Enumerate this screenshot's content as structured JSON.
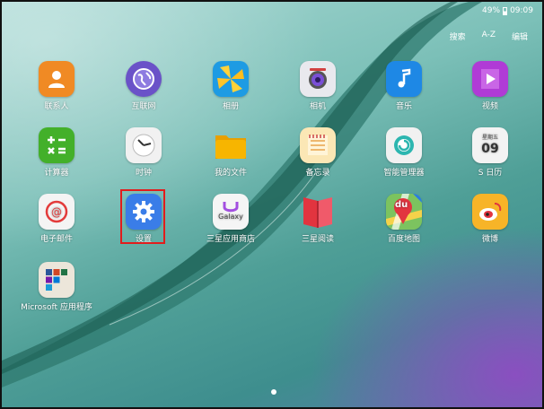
{
  "status": {
    "battery": "49%",
    "time": "09:09"
  },
  "topmenu": {
    "search": "搜索",
    "sort": "A-Z",
    "edit": "编辑"
  },
  "apps": [
    {
      "label": "联系人",
      "icon": "contacts-icon",
      "color": "#f08a24"
    },
    {
      "label": "互联网",
      "icon": "internet-icon",
      "color": "#6a52c8"
    },
    {
      "label": "相册",
      "icon": "gallery-icon",
      "color": "#f5c322"
    },
    {
      "label": "相机",
      "icon": "camera-icon",
      "color": "#e9e9ee"
    },
    {
      "label": "音乐",
      "icon": "music-icon",
      "color": "#1e88e5"
    },
    {
      "label": "视频",
      "icon": "video-icon",
      "color": "#b03bd6"
    },
    {
      "label": "计算器",
      "icon": "calculator-icon",
      "color": "#43b02a"
    },
    {
      "label": "时钟",
      "icon": "clock-icon",
      "color": "#f1f1f1"
    },
    {
      "label": "我的文件",
      "icon": "folder-icon",
      "color": "#f7b500"
    },
    {
      "label": "备忘录",
      "icon": "memo-icon",
      "color": "#fbe7b5"
    },
    {
      "label": "智能管理器",
      "icon": "smart-manager-icon",
      "color": "#f1f1f1"
    },
    {
      "label": "S 日历",
      "icon": "calendar-icon",
      "color": "#f3f3f3",
      "calendar_text": "星期五",
      "calendar_day": "09"
    },
    {
      "label": "电子邮件",
      "icon": "email-icon",
      "color": "#f4f4f4"
    },
    {
      "label": "设置",
      "icon": "settings-icon",
      "color": "#3a7de8"
    },
    {
      "label": "三星应用商店",
      "icon": "galaxy-apps-icon",
      "color": "#f5f5f5",
      "icon_text": "Galaxy"
    },
    {
      "label": "三星阅读",
      "icon": "reader-icon",
      "color": "#e2343f"
    },
    {
      "label": "百度地图",
      "icon": "baidu-map-icon",
      "color": "#5fb84a",
      "icon_text": "du"
    },
    {
      "label": "微博",
      "icon": "weibo-icon",
      "color": "#f7b428"
    },
    {
      "label": "Microsoft 应用程序",
      "icon": "microsoft-apps-folder-icon",
      "color": "#ece6da"
    }
  ]
}
